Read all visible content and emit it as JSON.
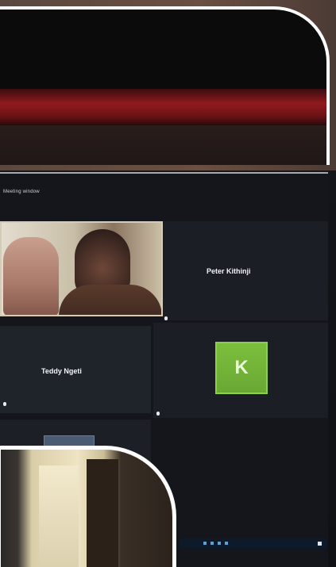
{
  "meeting": {
    "title": "Meeting window",
    "participants": [
      {
        "name": "",
        "tile_label": ""
      },
      {
        "name": "Peter Kithinji",
        "tile_label": ""
      },
      {
        "name": "Teddy Ngeti",
        "tile_label": ""
      },
      {
        "name": "K",
        "tile_label": ""
      }
    ]
  },
  "colors": {
    "accent_green": "#7bbf3d",
    "meeting_bg": "#14161b",
    "frame_red": "#8f1a1e"
  }
}
